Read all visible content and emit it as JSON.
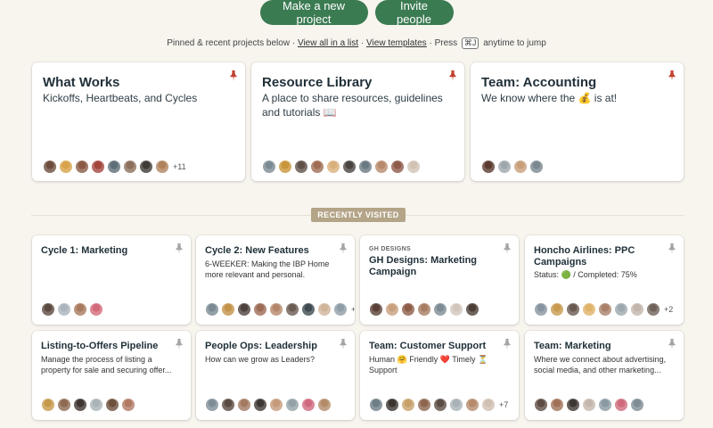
{
  "actions": {
    "new_project": "Make a new project",
    "invite": "Invite people"
  },
  "hint": {
    "prefix": "Pinned & recent projects below ·",
    "view_all": "View all in a list",
    "sep1": "·",
    "view_templates": "View templates",
    "press": "· Press",
    "shortcut": "⌘J",
    "suffix": "anytime to jump"
  },
  "pinned": [
    {
      "title": "What Works",
      "desc": "Kickoffs, Heartbeats, and Cycles",
      "avatars": [
        "#6d4c3d",
        "#d8a24a",
        "#8a5a44",
        "#a3453d",
        "#5e6e76",
        "#8b6f5a",
        "#3f3a36",
        "#b0825c"
      ],
      "more": "+11"
    },
    {
      "title": "Resource Library",
      "desc": "A place to share resources, guidelines and tutorials 📖",
      "avatars": [
        "#7c8a93",
        "#c9953a",
        "#5f5048",
        "#9f6c54",
        "#d9b07a",
        "#4a4440",
        "#6a7a82",
        "#b88a6c",
        "#8e5a4a",
        "#d2c2b4"
      ],
      "more": ""
    },
    {
      "title": "Team: Accounting",
      "desc": "We know where the 💰 is at!",
      "avatars": [
        "#5a3a2e",
        "#9ea8ad",
        "#c89f7a",
        "#7a8890"
      ],
      "more": ""
    }
  ],
  "recent_label": "RECENTLY VISITED",
  "recent": [
    {
      "eyebrow": "",
      "title": "Cycle 1: Marketing",
      "desc": "",
      "avatars": [
        "#5c4a40",
        "#aab4ba",
        "#a87a5e",
        "#d36a7a"
      ],
      "more": ""
    },
    {
      "eyebrow": "",
      "title": "Cycle 2: New Features",
      "desc": "6-WEEKER: Making the IBP Home more relevant and personal.",
      "avatars": [
        "#7a8a92",
        "#c4934a",
        "#4d423c",
        "#9d6b55",
        "#b5876a",
        "#6b5b52",
        "#3e4a50",
        "#d0b49a",
        "#8f9ea6"
      ],
      "more": "+3"
    },
    {
      "eyebrow": "GH DESIGNS",
      "title": "GH Designs: Marketing Campaign",
      "desc": "",
      "avatars": [
        "#5a4036",
        "#c9a07e",
        "#8d5d48",
        "#a67c62",
        "#7d8c94",
        "#d2c6bc",
        "#4b3d36"
      ],
      "more": ""
    },
    {
      "eyebrow": "",
      "title": "Honcho Airlines: PPC Campaigns",
      "desc": "Status: 🟢 / Completed: 75%",
      "avatars": [
        "#8794a0",
        "#c79a4e",
        "#6a5a50",
        "#dfb36a",
        "#a98068",
        "#9ca8ae",
        "#c2b6ac",
        "#6f625a"
      ],
      "more": "+2"
    },
    {
      "eyebrow": "",
      "title": "Listing-to-Offers Pipeline",
      "desc": "Manage the process of listing a property for sale and securing offer...",
      "avatars": [
        "#c69a4c",
        "#8e6a52",
        "#3f3631",
        "#aab3b8",
        "#6c4f3c",
        "#b27a64"
      ],
      "more": ""
    },
    {
      "eyebrow": "",
      "title": "People Ops: Leadership",
      "desc": "How can we grow as Leaders?",
      "avatars": [
        "#7f8e96",
        "#5a4a42",
        "#a37a62",
        "#3e3834",
        "#c59a7a",
        "#94a2a8",
        "#d06a80",
        "#b38c6a"
      ],
      "more": ""
    },
    {
      "eyebrow": "",
      "title": "Team: Customer Support",
      "desc": "Human 🤗 Friendly ❤️ Timely ⏳ Support",
      "avatars": [
        "#6e7e86",
        "#3b3430",
        "#c8a06a",
        "#8d6650",
        "#5b4c44",
        "#a8b2b7",
        "#b68a6a",
        "#d0c0b2"
      ],
      "more": "+7"
    },
    {
      "eyebrow": "",
      "title": "Team: Marketing",
      "desc": "Where we connect about advertising, social media, and other marketing...",
      "avatars": [
        "#5d4c44",
        "#9f7258",
        "#3e3632",
        "#c4b8ae",
        "#8a9aa2",
        "#cf6a7c",
        "#7f8c94"
      ],
      "more": ""
    }
  ],
  "colors": {
    "button_green": "#3b7b52",
    "pin_red": "#c2412f",
    "pin_gray": "#a5a5a5",
    "badge_tan": "#b4a488",
    "background": "#f8f5ef"
  }
}
